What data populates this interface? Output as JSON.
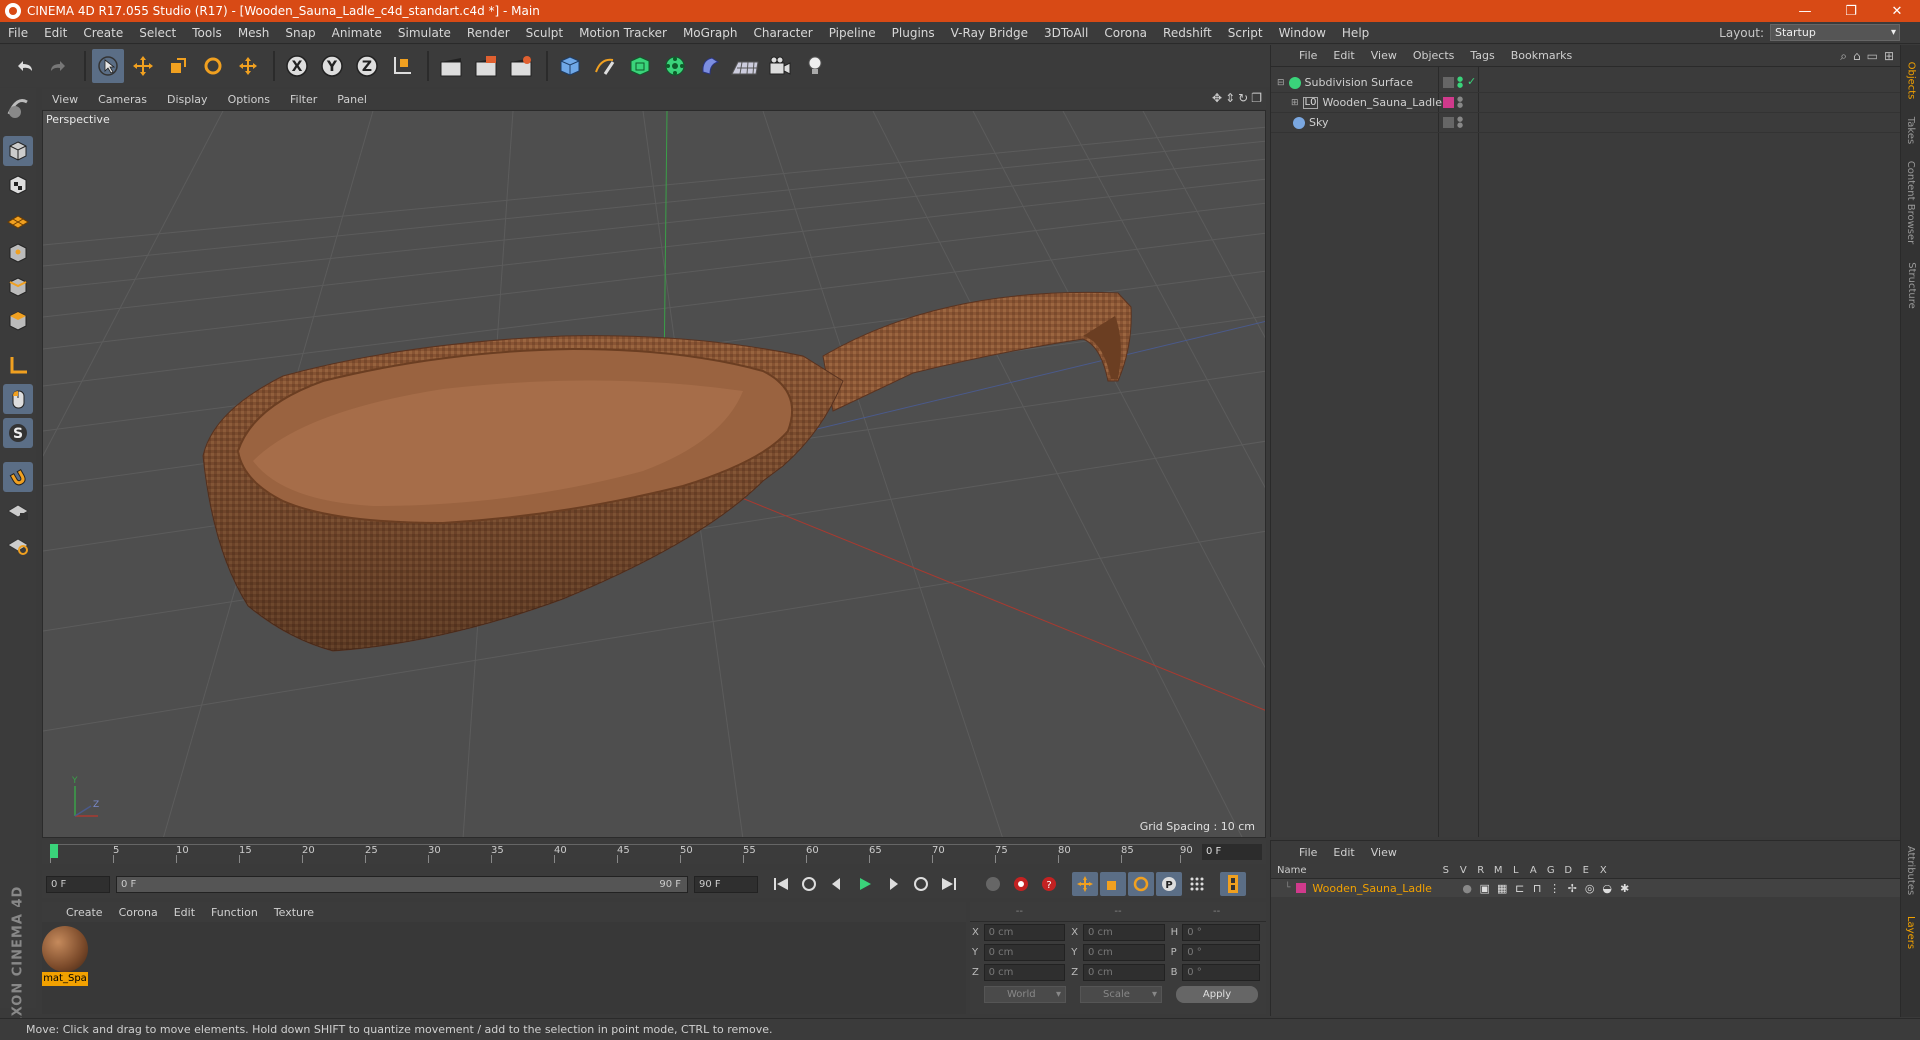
{
  "window": {
    "title": "CINEMA 4D R17.055 Studio (R17) - [Wooden_Sauna_Ladle_c4d_standart.c4d *] - Main",
    "minimize": "—",
    "maximize": "❐",
    "close": "✕"
  },
  "menubar": {
    "items": [
      "File",
      "Edit",
      "Create",
      "Select",
      "Tools",
      "Mesh",
      "Snap",
      "Animate",
      "Simulate",
      "Render",
      "Sculpt",
      "Motion Tracker",
      "MoGraph",
      "Character",
      "Pipeline",
      "Plugins",
      "V-Ray Bridge",
      "3DToAll",
      "Corona",
      "Redshift",
      "Script",
      "Window",
      "Help"
    ],
    "layout_label": "Layout:",
    "layout_value": "Startup"
  },
  "viewport": {
    "menu": [
      "View",
      "Cameras",
      "Display",
      "Options",
      "Filter",
      "Panel"
    ],
    "label": "Perspective",
    "grid_spacing": "Grid Spacing : 10 cm"
  },
  "timeline": {
    "ticks": [
      "0",
      "5",
      "10",
      "15",
      "20",
      "25",
      "30",
      "35",
      "40",
      "45",
      "50",
      "55",
      "60",
      "65",
      "70",
      "75",
      "80",
      "85",
      "90"
    ],
    "current_frame": "0 F"
  },
  "playbar": {
    "start": "0 F",
    "range_start": "0 F",
    "range_end": "90 F",
    "end": "90 F"
  },
  "material_manager": {
    "menu": [
      "Create",
      "Corona",
      "Edit",
      "Function",
      "Texture"
    ],
    "materials": [
      {
        "name": "mat_Spa"
      }
    ]
  },
  "coordinates": {
    "headers": [
      "--",
      "--",
      "--"
    ],
    "rows": [
      {
        "a": "X",
        "av": "0 cm",
        "b": "X",
        "bv": "0 cm",
        "c": "H",
        "cv": "0 °"
      },
      {
        "a": "Y",
        "av": "0 cm",
        "b": "Y",
        "bv": "0 cm",
        "c": "P",
        "cv": "0 °"
      },
      {
        "a": "Z",
        "av": "0 cm",
        "b": "Z",
        "bv": "0 cm",
        "c": "B",
        "cv": "0 °"
      }
    ],
    "mode": "World",
    "size_mode": "Scale",
    "apply": "Apply"
  },
  "object_manager": {
    "menu": [
      "File",
      "Edit",
      "View",
      "Objects",
      "Tags",
      "Bookmarks"
    ],
    "objects": [
      {
        "name": "Subdivision Surface",
        "color": "#3ad37a"
      },
      {
        "name": "Wooden_Sauna_Ladle",
        "color": "#d03a8c"
      },
      {
        "name": "Sky",
        "color": "#7aa7e0"
      }
    ]
  },
  "layer_manager": {
    "menu": [
      "File",
      "Edit",
      "View"
    ],
    "columns": [
      "Name",
      "S",
      "V",
      "R",
      "M",
      "L",
      "A",
      "G",
      "D",
      "E",
      "X"
    ],
    "layers": [
      {
        "name": "Wooden_Sauna_Ladle",
        "color": "#d03a8c"
      }
    ]
  },
  "right_tabs": [
    "Objects",
    "Takes",
    "Content Browser",
    "Structure",
    "Attributes",
    "Layers"
  ],
  "status": "Move: Click and drag to move elements. Hold down SHIFT to quantize movement / add to the selection in point mode, CTRL to remove."
}
